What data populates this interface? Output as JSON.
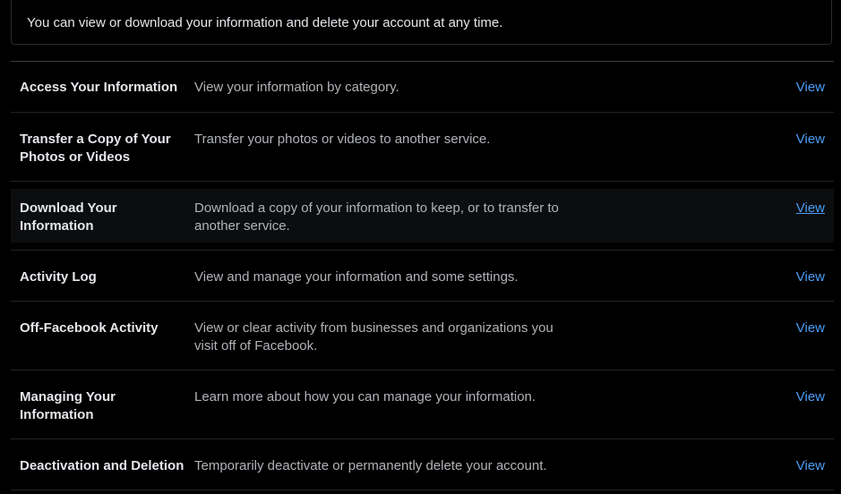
{
  "intro": {
    "text": "You can view or download your information and delete your account at any time."
  },
  "rows": [
    {
      "title": "Access Your Information",
      "description": "View your information by category.",
      "link": "View"
    },
    {
      "title": "Transfer a Copy of Your Photos or Videos",
      "description": "Transfer your photos or videos to another service.",
      "link": "View"
    },
    {
      "title": "Download Your Information",
      "description": "Download a copy of your information to keep, or to transfer to another service.",
      "link": "View"
    },
    {
      "title": "Activity Log",
      "description": "View and manage your information and some settings.",
      "link": "View"
    },
    {
      "title": "Off-Facebook Activity",
      "description": "View or clear activity from businesses and organizations you visit off of Facebook.",
      "link": "View"
    },
    {
      "title": "Managing Your Information",
      "description": "Learn more about how you can manage your information.",
      "link": "View"
    },
    {
      "title": "Deactivation and Deletion",
      "description": "Temporarily deactivate or permanently delete your account.",
      "link": "View"
    }
  ],
  "colors": {
    "background": "#000000",
    "title_text": "#e4e6eb",
    "description_text": "#b0b3b8",
    "link": "#4d9ef7"
  }
}
